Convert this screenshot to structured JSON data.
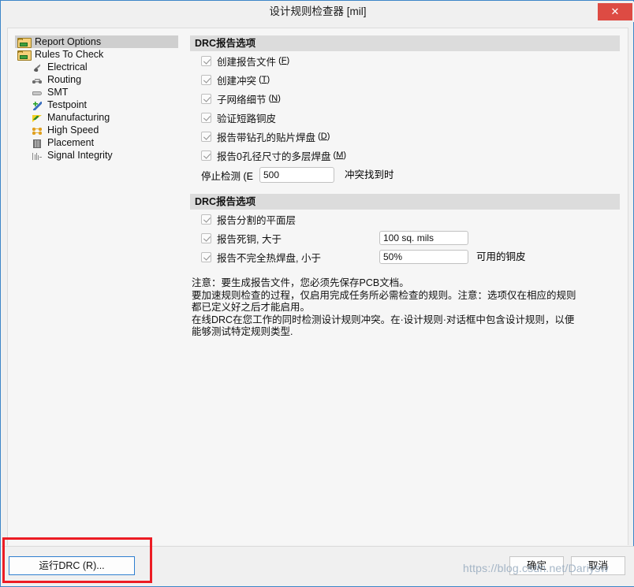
{
  "window": {
    "title": "设计规则检查器 [mil]",
    "close_label": "✕",
    "accent_blue": "#3d85c8",
    "close_red": "#dd4b43",
    "highlight_red": "#ec1c24"
  },
  "sidebar": {
    "items": [
      {
        "label": "Report Options",
        "icon": "folder-icon",
        "level": 0,
        "selected": true
      },
      {
        "label": "Rules To Check",
        "icon": "folder-icon",
        "level": 0,
        "selected": false
      },
      {
        "label": "Electrical",
        "icon": "electrical-icon",
        "level": 1,
        "selected": false
      },
      {
        "label": "Routing",
        "icon": "routing-icon",
        "level": 1,
        "selected": false
      },
      {
        "label": "SMT",
        "icon": "smt-icon",
        "level": 1,
        "selected": false
      },
      {
        "label": "Testpoint",
        "icon": "testpoint-icon",
        "level": 1,
        "selected": false
      },
      {
        "label": "Manufacturing",
        "icon": "manufacturing-icon",
        "level": 1,
        "selected": false
      },
      {
        "label": "High Speed",
        "icon": "high-speed-icon",
        "level": 1,
        "selected": false
      },
      {
        "label": "Placement",
        "icon": "placement-icon",
        "level": 1,
        "selected": false
      },
      {
        "label": "Signal Integrity",
        "icon": "signal-integrity-icon",
        "level": 1,
        "selected": false
      }
    ]
  },
  "section1": {
    "header": "DRC报告选项",
    "options": [
      {
        "label": "创建报告文件",
        "mnemonic": "F",
        "checked": true
      },
      {
        "label": "创建冲突",
        "mnemonic": "T",
        "checked": true
      },
      {
        "label": "子网络细节",
        "mnemonic": "N",
        "checked": true
      },
      {
        "label": "验证短路铜皮",
        "mnemonic": "",
        "checked": true
      },
      {
        "label": "报告带钻孔的贴片焊盘",
        "mnemonic": "D",
        "checked": true
      },
      {
        "label": "报告0孔径尺寸的多层焊盘",
        "mnemonic": "M",
        "checked": true
      }
    ],
    "stop_row": {
      "label": "停止检测 (E",
      "value": "500",
      "placeholder": "",
      "suffix": "冲突找到时"
    }
  },
  "section2": {
    "header": "DRC报告选项",
    "options": [
      {
        "label": "报告分割的平面层",
        "checked": true,
        "value": null,
        "after": ""
      },
      {
        "label": "报告死铜, 大于",
        "checked": true,
        "value": "100 sq. mils",
        "after": ""
      },
      {
        "label": "报告不完全热焊盘, 小于",
        "checked": true,
        "value": "50%",
        "after": "可用的铜皮"
      }
    ]
  },
  "note": "注意：要生成报告文件，您必须先保存PCB文档。\n要加速规则检查的过程，仅启用完成任务所必需检查的规则。注意：选项仅在相应的规则\n都已定义好之后才能启用。\n在线DRC在您工作的同时检测设计规则冲突。在·设计规则·对话框中包含设计规则，以便\n能够测试特定规则类型.",
  "footer": {
    "run_drc_label": "运行DRC (R)...",
    "ok_label": "确定",
    "cancel_label": "取消"
  },
  "watermark": "https://blog.csdn.net/Dariysw"
}
